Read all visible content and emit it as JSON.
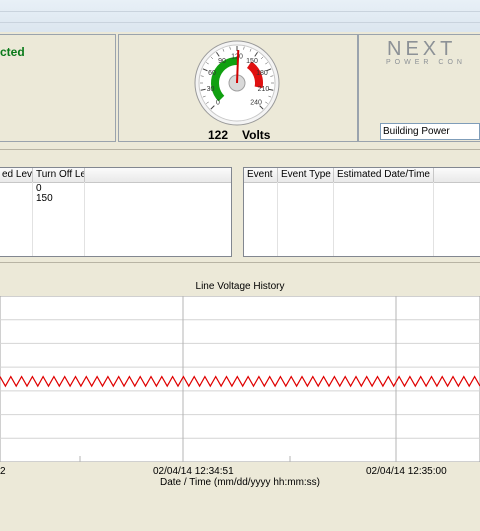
{
  "status": {
    "text": "cted"
  },
  "gauge": {
    "value": 122,
    "min": 0,
    "max": 240,
    "tick_labels": [
      "0",
      "30",
      "60",
      "90",
      "120",
      "150",
      "180",
      "210",
      "240"
    ],
    "reading": "122",
    "unit": "Volts",
    "colors": {
      "green": "#10a010",
      "red": "#e01010",
      "needle": "#d00000"
    }
  },
  "logo": {
    "name": "NEXT",
    "subtitle": "POWER CON"
  },
  "building_input": {
    "value": "Building Power"
  },
  "load_table": {
    "headers": [
      "ed Level",
      "Turn Off Level"
    ],
    "rows": [
      [
        "",
        "0"
      ],
      [
        "",
        "150"
      ]
    ]
  },
  "event_table": {
    "headers": [
      "Event",
      "Event Type",
      "Estimated Date/Time"
    ],
    "rows": []
  },
  "chart_data": {
    "type": "line",
    "title": "Line Voltage History",
    "xlabel": "Date / Time (mm/dd/yyyy hh:mm:ss)",
    "ylabel": "",
    "x_tick_labels": [
      "2",
      "02/04/14 12:34:51",
      "02/04/14 12:35:00"
    ],
    "series": [
      {
        "color": "#e00000",
        "values": [
          123,
          121,
          123,
          121,
          123,
          121,
          123,
          121,
          123,
          121,
          123,
          121,
          123,
          121,
          123,
          121,
          123,
          121,
          123,
          121,
          123,
          121,
          123,
          121,
          123,
          121,
          123,
          121,
          123,
          121,
          123,
          121,
          123,
          121,
          123,
          121,
          123,
          121,
          123,
          121,
          123,
          121,
          123,
          121,
          123,
          121,
          123,
          121,
          123,
          121,
          123,
          121,
          123,
          121,
          123,
          121,
          123,
          121,
          123,
          121,
          123,
          121,
          123,
          121,
          123,
          121,
          123,
          121,
          123,
          121,
          123,
          121,
          123,
          121,
          123,
          121,
          123,
          121,
          123,
          121,
          123,
          121,
          123,
          121,
          123,
          121,
          123,
          121,
          123,
          121
        ]
      }
    ],
    "ylim": [
      105,
      140
    ],
    "grid": true
  }
}
